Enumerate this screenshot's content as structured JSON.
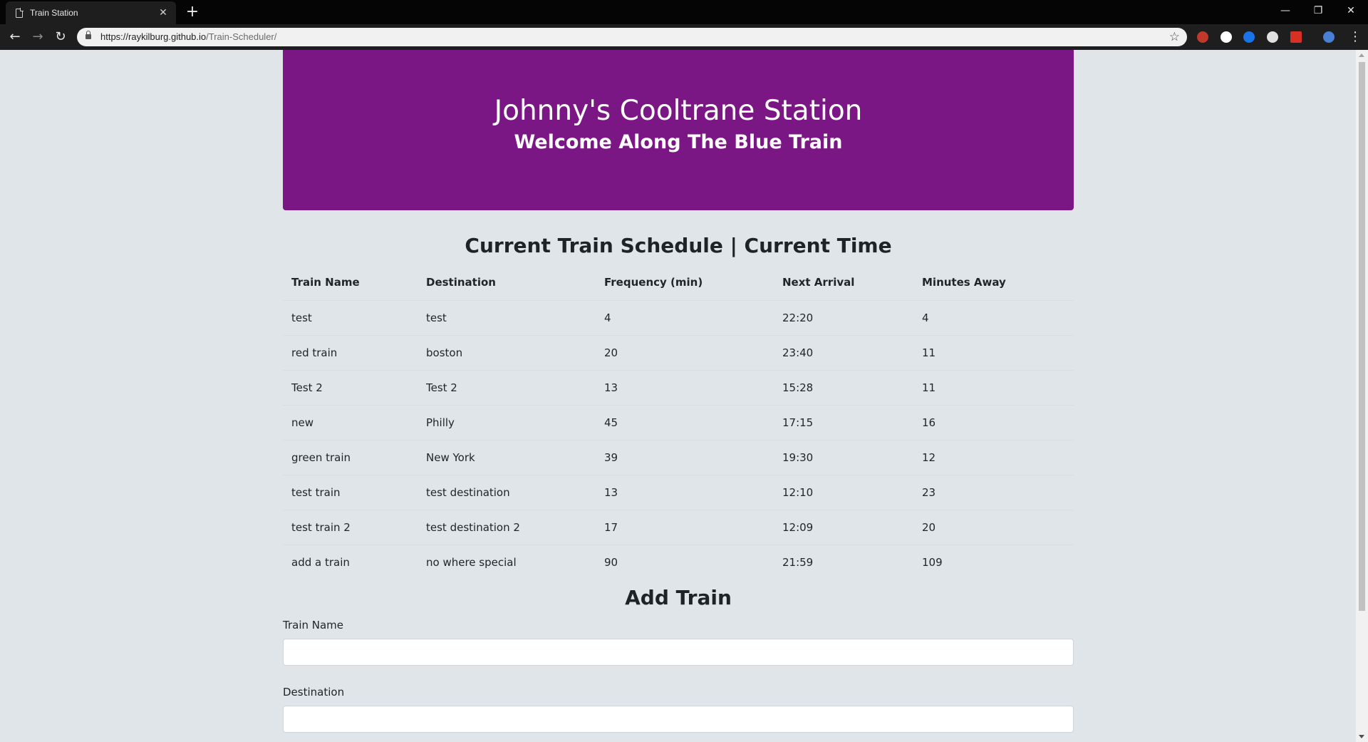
{
  "browser": {
    "tab_title": "Train Station",
    "tab_close": "✕",
    "new_tab": "+",
    "url_host": "https://raykilburg.github.io",
    "url_path": "/Train-Scheduler/",
    "controls": {
      "minimize": "—",
      "restore": "❐",
      "close": "✕"
    },
    "nav": {
      "back": "←",
      "forward": "→",
      "reload": "↻",
      "star": "☆",
      "menu": "⋮"
    },
    "extensions": [
      {
        "name": "ublock-extension-icon",
        "color": "#c0392b"
      },
      {
        "name": "circle-extension-icon",
        "color": "#ffffff"
      },
      {
        "name": "pen-extension-icon",
        "color": "#1a73e8"
      },
      {
        "name": "react-extension-icon",
        "color": "#e0e0e0"
      },
      {
        "name": "css-extension-icon",
        "color": "#d93025"
      },
      {
        "name": "profile-avatar-icon",
        "color": "#4a7fd6"
      }
    ]
  },
  "header": {
    "title": "Johnny's Cooltrane Station",
    "subtitle": "Welcome Along The Blue Train",
    "background": "#7b1785"
  },
  "schedule": {
    "heading": "Current Train Schedule | Current Time",
    "columns": [
      "Train Name",
      "Destination",
      "Frequency (min)",
      "Next Arrival",
      "Minutes Away"
    ],
    "rows": [
      [
        "test",
        "test",
        "4",
        "22:20",
        "4"
      ],
      [
        "red train",
        "boston",
        "20",
        "23:40",
        "11"
      ],
      [
        "Test 2",
        "Test 2",
        "13",
        "15:28",
        "11"
      ],
      [
        "new",
        "Philly",
        "45",
        "17:15",
        "16"
      ],
      [
        "green train",
        "New York",
        "39",
        "19:30",
        "12"
      ],
      [
        "test train",
        "test destination",
        "13",
        "12:10",
        "23"
      ],
      [
        "test train 2",
        "test destination 2",
        "17",
        "12:09",
        "20"
      ],
      [
        "add a train",
        "no where special",
        "90",
        "21:59",
        "109"
      ]
    ]
  },
  "add_train": {
    "heading": "Add Train",
    "fields": [
      {
        "label": "Train Name",
        "value": ""
      },
      {
        "label": "Destination",
        "value": ""
      }
    ]
  }
}
